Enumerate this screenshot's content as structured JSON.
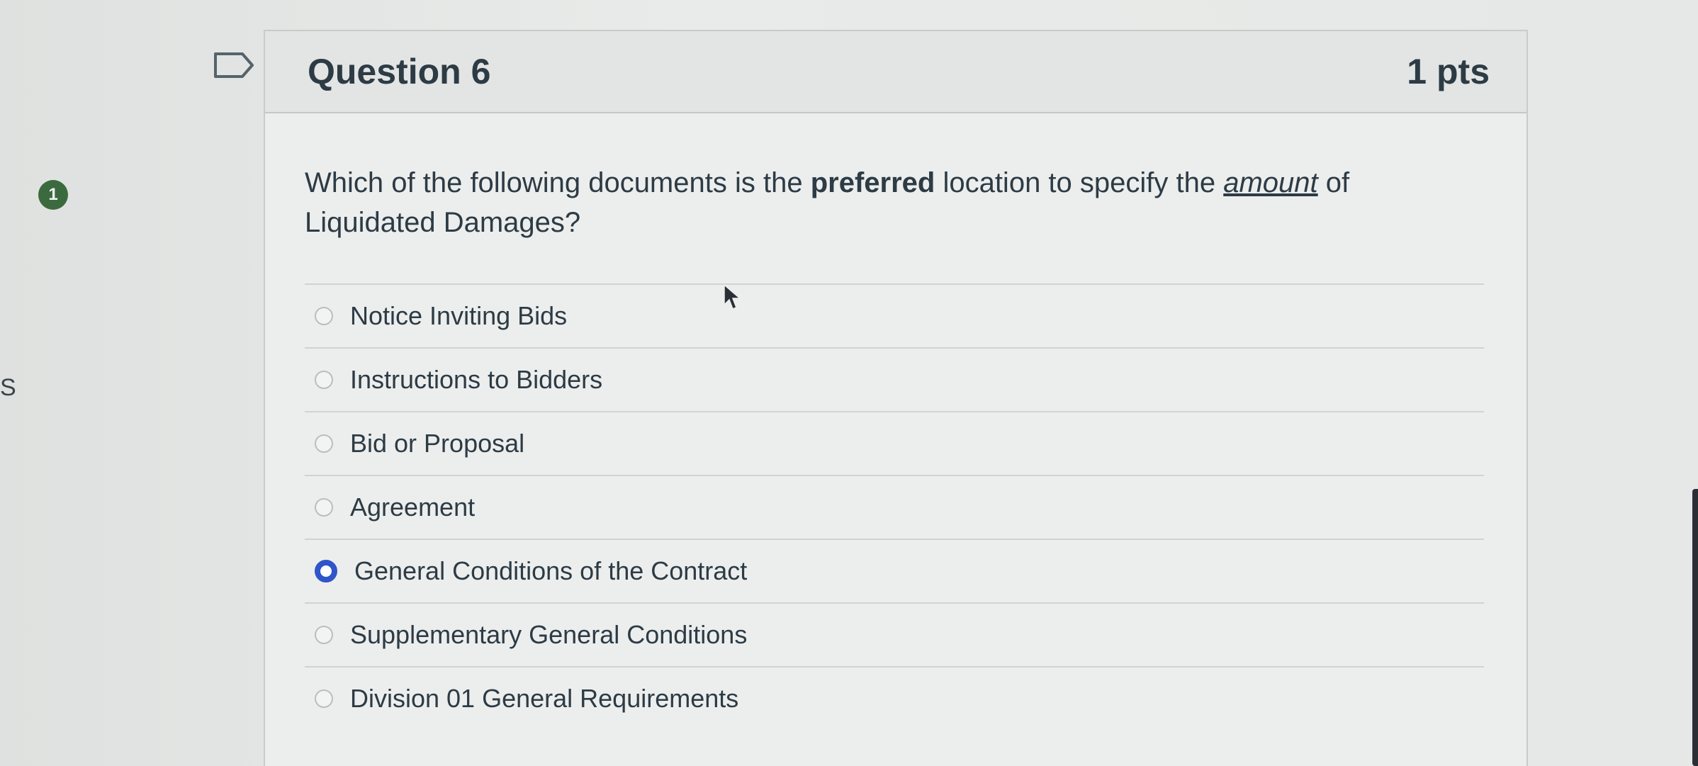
{
  "sidebar": {
    "partial_letter": "S",
    "question_number_badge": "1"
  },
  "question": {
    "title": "Question 6",
    "points": "1 pts",
    "text_before_bold": "Which of the following documents is the ",
    "text_bold": "preferred",
    "text_middle": " location to specify the ",
    "text_emphasis": "amount",
    "text_after": " of Liquidated Damages?",
    "answers": [
      {
        "label": "Notice Inviting Bids",
        "selected": false
      },
      {
        "label": "Instructions to Bidders",
        "selected": false
      },
      {
        "label": "Bid or Proposal",
        "selected": false
      },
      {
        "label": "Agreement",
        "selected": false
      },
      {
        "label": "General Conditions of the Contract",
        "selected": true
      },
      {
        "label": "Supplementary General Conditions",
        "selected": false
      },
      {
        "label": "Division 01 General Requirements",
        "selected": false
      }
    ]
  },
  "colors": {
    "selected_radio": "#2f55c8",
    "badge": "#3b6a3e",
    "text": "#2d3b45"
  },
  "icons": {
    "flag": "flag-bookmark-icon",
    "cursor": "mouse-pointer-icon"
  }
}
